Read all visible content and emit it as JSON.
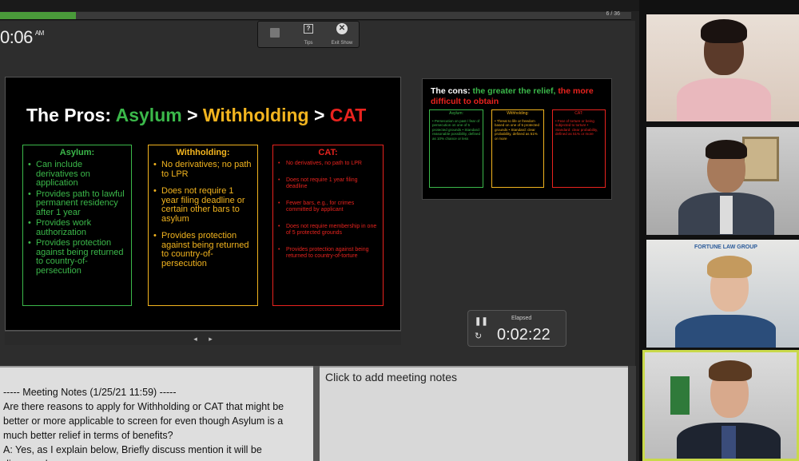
{
  "header": {
    "progress_percent": 12,
    "slide_counter": "6 / 36",
    "clock_time": "0:06",
    "clock_ampm": "AM"
  },
  "toolbar": {
    "items": [
      {
        "label": "",
        "icon": "slides-icon"
      },
      {
        "label": "Tips",
        "icon": "help-icon"
      },
      {
        "label": "Exit Show",
        "icon": "close-icon"
      }
    ]
  },
  "slide": {
    "title_prefix": "The Pros: ",
    "title_asylum": "Asylum",
    "title_sep1": " > ",
    "title_withholding": "Withholding",
    "title_sep2": " > ",
    "title_cat": "CAT",
    "boxes": [
      {
        "heading": "Asylum:",
        "items": [
          "Can include derivatives on application",
          "Provides path to lawful permanent residency after 1 year",
          "Provides work authorization",
          "Provides protection against being returned to country-of-persecution"
        ]
      },
      {
        "heading": "Withholding:",
        "items": [
          "No derivatives; no path to LPR",
          "Does not require 1 year filing deadline or certain other bars to asylum",
          "Provides protection against being returned to country-of-persecution"
        ]
      },
      {
        "heading": "CAT:",
        "items": [
          "No derivatives, no path to LPR",
          "Does not require 1 year filing deadline",
          "Fewer bars, e.g., for crimes committed by applicant",
          "Does not require membership in one of 5 protected grounds",
          "Provides protection against being returned to country-of-torture"
        ]
      }
    ],
    "nav_prev": "◂",
    "nav_next": "▸"
  },
  "next_slide": {
    "title_prefix": "The cons: ",
    "title_green": "the greater the relief, ",
    "title_red": "the more difficult to obtain",
    "boxes": [
      {
        "heading": "Asylum:",
        "text": "• Persecution on past / fear of persecution on one of 5 protected grounds • Standard: reasonable possibility, defined as 10% chance or less"
      },
      {
        "heading": "Withholding:",
        "text": "• Threat to life or freedom based on one of 5 protected grounds • Standard: clear probability, defined as 51% or more"
      },
      {
        "heading": "CAT:",
        "text": "• Fear of torture or being subjected to torture • Standard: clear probability, defined as 51% or more"
      }
    ]
  },
  "timer": {
    "label": "Elapsed",
    "time": "0:02:22"
  },
  "notes": {
    "header": "----- Meeting Notes (1/25/21 11:59) -----",
    "body": "Are there reasons to apply for Withholding or CAT that might be better or more applicable to screen for even though Asylum is a much better relief in terms of benefits?",
    "body2": "A: Yes, as I explain below, Briefly discuss mention it will be discussed",
    "placeholder": "Click to add meeting notes"
  },
  "video": {
    "tile3_logo": "FORTUNE LAW GROUP"
  },
  "colors": {
    "asylum": "#3bb84a",
    "withholding": "#f2b41f",
    "cat": "#e8231e",
    "progress": "#4a9b3a",
    "active_speaker": "#c9d94a"
  }
}
